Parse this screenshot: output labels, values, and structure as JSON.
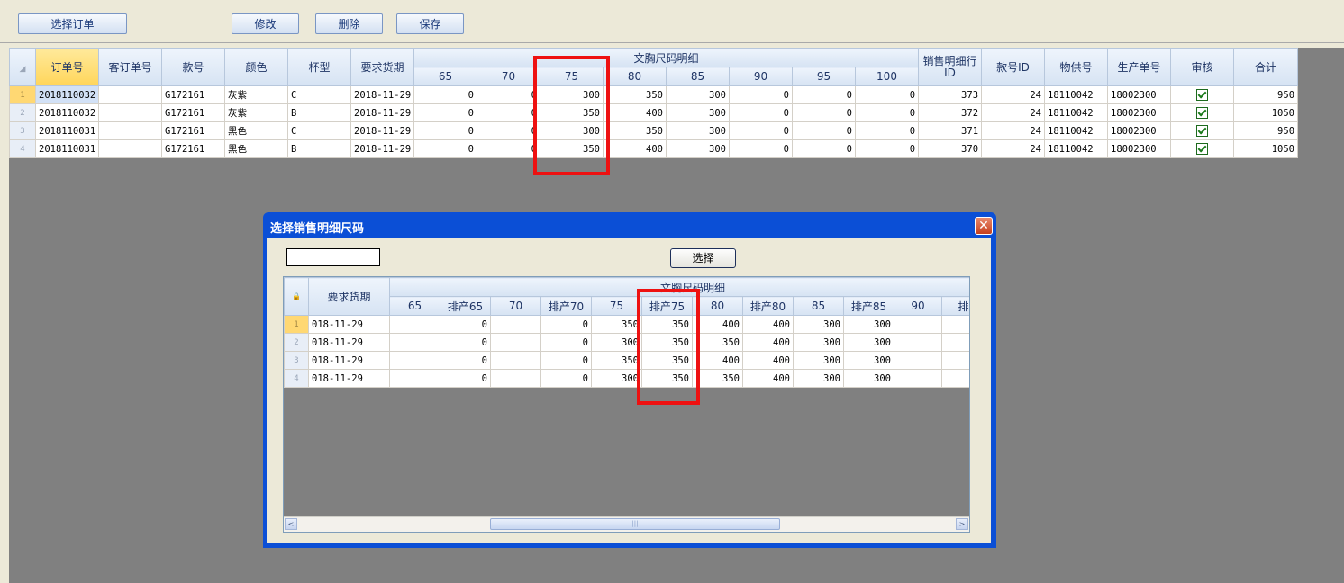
{
  "toolbar": {
    "select_order": "选择订单",
    "modify": "修改",
    "delete": "删除",
    "save": "保存"
  },
  "main_grid": {
    "group_header": "文胸尺码明细",
    "headers": {
      "order_no": "订单号",
      "customer_order_no": "客订单号",
      "style_no": "款号",
      "color": "颜色",
      "cup": "杯型",
      "due_date": "要求货期",
      "sales_detail_id": "销售明细行ID",
      "style_id": "款号ID",
      "supplier_no": "物供号",
      "production_no": "生产单号",
      "review": "审核",
      "total": "合计"
    },
    "size_headers": [
      "65",
      "70",
      "75",
      "80",
      "85",
      "90",
      "95",
      "100"
    ],
    "rows": [
      {
        "rn": "1",
        "order_no": "2018110032",
        "customer_order_no": "",
        "style_no": "G172161",
        "color": "灰紫",
        "cup": "C",
        "due_date": "2018-11-29",
        "sizes": [
          "0",
          "0",
          "300",
          "350",
          "300",
          "0",
          "0",
          "0"
        ],
        "sales_detail_id": "373",
        "style_id": "24",
        "supplier_no": "18110042",
        "production_no": "18002300",
        "review": true,
        "total": "950"
      },
      {
        "rn": "2",
        "order_no": "2018110032",
        "customer_order_no": "",
        "style_no": "G172161",
        "color": "灰紫",
        "cup": "B",
        "due_date": "2018-11-29",
        "sizes": [
          "0",
          "0",
          "350",
          "400",
          "300",
          "0",
          "0",
          "0"
        ],
        "sales_detail_id": "372",
        "style_id": "24",
        "supplier_no": "18110042",
        "production_no": "18002300",
        "review": true,
        "total": "1050"
      },
      {
        "rn": "3",
        "order_no": "2018110031",
        "customer_order_no": "",
        "style_no": "G172161",
        "color": "黑色",
        "cup": "C",
        "due_date": "2018-11-29",
        "sizes": [
          "0",
          "0",
          "300",
          "350",
          "300",
          "0",
          "0",
          "0"
        ],
        "sales_detail_id": "371",
        "style_id": "24",
        "supplier_no": "18110042",
        "production_no": "18002300",
        "review": true,
        "total": "950"
      },
      {
        "rn": "4",
        "order_no": "2018110031",
        "customer_order_no": "",
        "style_no": "G172161",
        "color": "黑色",
        "cup": "B",
        "due_date": "2018-11-29",
        "sizes": [
          "0",
          "0",
          "350",
          "400",
          "300",
          "0",
          "0",
          "0"
        ],
        "sales_detail_id": "370",
        "style_id": "24",
        "supplier_no": "18110042",
        "production_no": "18002300",
        "review": true,
        "total": "1050"
      }
    ]
  },
  "dialog": {
    "title": "选择销售明细尺码",
    "close_glyph": "✕",
    "search_value": "",
    "select_button": "选择",
    "grid": {
      "lock_glyph": "🔒",
      "due_date_header": "要求货期",
      "group_header": "文胸尺码明细",
      "sub_headers": [
        "65",
        "排产65",
        "70",
        "排产70",
        "75",
        "排产75",
        "80",
        "排产80",
        "85",
        "排产85",
        "90",
        "排产"
      ],
      "rows": [
        {
          "rn": "1",
          "due_date": "018-11-29",
          "cells": [
            "",
            "0",
            "",
            "0",
            "350",
            "350",
            "400",
            "400",
            "300",
            "300",
            "",
            ""
          ]
        },
        {
          "rn": "2",
          "due_date": "018-11-29",
          "cells": [
            "",
            "0",
            "",
            "0",
            "300",
            "350",
            "350",
            "400",
            "300",
            "300",
            "",
            ""
          ]
        },
        {
          "rn": "3",
          "due_date": "018-11-29",
          "cells": [
            "",
            "0",
            "",
            "0",
            "350",
            "350",
            "400",
            "400",
            "300",
            "300",
            "",
            ""
          ]
        },
        {
          "rn": "4",
          "due_date": "018-11-29",
          "cells": [
            "",
            "0",
            "",
            "0",
            "300",
            "350",
            "350",
            "400",
            "300",
            "300",
            "",
            ""
          ]
        }
      ],
      "scroll_left": "<",
      "scroll_right": ">",
      "scroll_grip": "|||"
    }
  },
  "colors": {
    "highlight_box": "#ee1111",
    "dialog_frame": "#0b4fd6",
    "selected_header": "#ffd55a"
  }
}
